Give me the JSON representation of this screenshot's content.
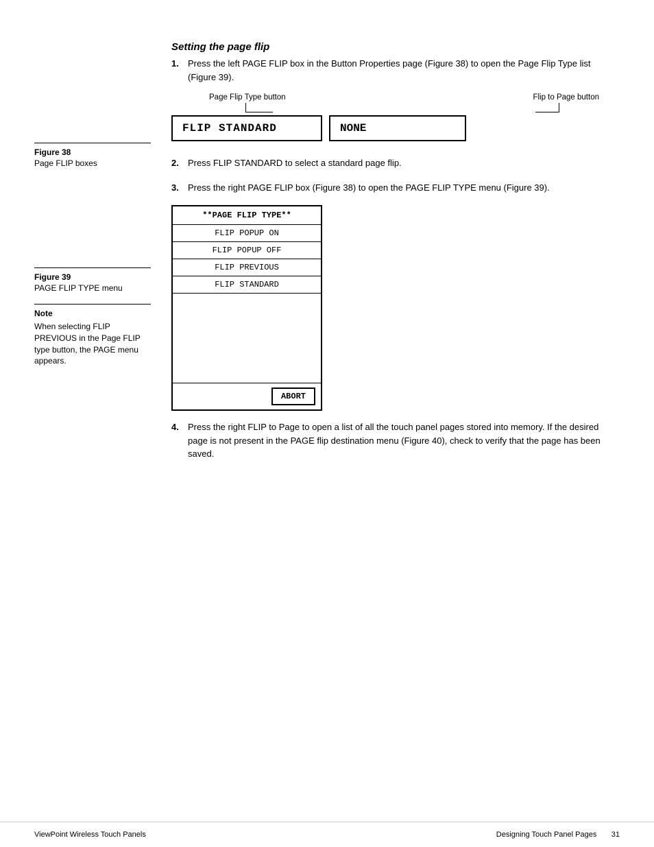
{
  "section": {
    "title": "Setting the page flip"
  },
  "steps": [
    {
      "number": "1.",
      "text": "Press the left PAGE FLIP box in the Button Properties page (Figure 38) to open the Page Flip Type list (Figure 39)."
    },
    {
      "number": "2.",
      "text": "Press FLIP STANDARD to select a standard page flip."
    },
    {
      "number": "3.",
      "text": "Press the right PAGE FLIP box (Figure 38) to open the PAGE FLIP TYPE menu (Figure 39)."
    },
    {
      "number": "4.",
      "text": "Press the right FLIP to Page to open a list of all the touch panel pages stored into memory. If the desired page is not present in the PAGE flip destination menu (Figure 40), check to verify that the page has been saved."
    }
  ],
  "figure38": {
    "label": "Figure 38",
    "desc": "Page FLIP boxes",
    "label_left": "Page Flip Type button",
    "label_right": "Flip to Page button",
    "box_left": "FLIP STANDARD",
    "box_right": "NONE"
  },
  "figure39": {
    "label": "Figure 39",
    "desc": "PAGE FLIP TYPE menu",
    "menu": {
      "header": "**PAGE FLIP TYPE**",
      "items": [
        "FLIP POPUP ON",
        "FLIP POPUP OFF",
        "FLIP PREVIOUS",
        "FLIP STANDARD"
      ],
      "abort": "ABORT"
    }
  },
  "note": {
    "title": "Note",
    "text": "When selecting FLIP PREVIOUS in the Page FLIP type button, the PAGE menu appears."
  },
  "footer": {
    "left": "ViewPoint Wireless Touch Panels",
    "right": "Designing Touch Panel Pages",
    "page": "31"
  }
}
